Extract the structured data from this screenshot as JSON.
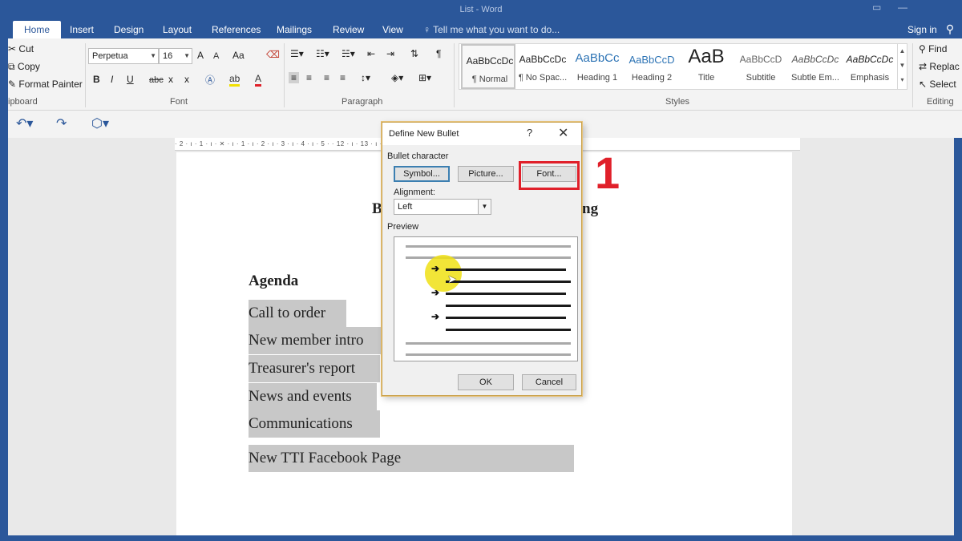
{
  "window": {
    "title": "List - Word"
  },
  "tabs": [
    "Home",
    "Insert",
    "Design",
    "Layout",
    "References",
    "Mailings",
    "Review",
    "View"
  ],
  "tell_me": "Tell me what you want to do...",
  "sign_in": "Sign in",
  "ribbon": {
    "clipboard": {
      "cut": "Cut",
      "copy": "Copy",
      "format_painter": "Format Painter",
      "label": "ipboard"
    },
    "font": {
      "name": "Perpetua",
      "size": "16",
      "label": "Font",
      "grow": "A",
      "shrink": "A",
      "case": "Aa",
      "bold": "B",
      "italic": "I",
      "underline": "U",
      "strike": "abc",
      "sub": "x",
      "sup": "x"
    },
    "paragraph": {
      "label": "Paragraph"
    },
    "styles": {
      "label": "Styles",
      "items": [
        {
          "preview": "AaBbCcDc",
          "name": "¶ Normal"
        },
        {
          "preview": "AaBbCcDc",
          "name": "¶ No Spac..."
        },
        {
          "preview": "AaBbCc",
          "name": "Heading 1"
        },
        {
          "preview": "AaBbCcD",
          "name": "Heading 2"
        },
        {
          "preview": "AaB",
          "name": "Title"
        },
        {
          "preview": "AaBbCcD",
          "name": "Subtitle"
        },
        {
          "preview": "AaBbCcDc",
          "name": "Subtle Em..."
        },
        {
          "preview": "AaBbCcDc",
          "name": "Emphasis"
        }
      ]
    },
    "editing": {
      "find": "Find",
      "replace": "Replac",
      "select": "Select",
      "label": "Editing"
    }
  },
  "ruler_text": "· 2 · ı · 1 · ı · ✕ · ı · 1 · ı · 2 · ı · 3 · ı · 4 · ı · 5 ·                                                 · 12 · ı · 13 · ı · 14 · ı · 15 · ı · 16 · △ · 17 · ı · 18 · ı · 19",
  "document": {
    "heading_left": "B",
    "heading_right": "ng",
    "agenda": "Agenda",
    "lines": [
      "Call to order",
      "New member intro",
      "Treasurer's report",
      "News and events",
      "Communications",
      "New TTI Facebook Page"
    ]
  },
  "dialog": {
    "title": "Define New Bullet",
    "help": "?",
    "close": "✕",
    "bullet_character": "Bullet character",
    "symbol_btn": "Symbol...",
    "picture_btn": "Picture...",
    "font_btn": "Font...",
    "alignment_label": "Alignment:",
    "alignment_value": "Left",
    "preview_label": "Preview",
    "ok": "OK",
    "cancel": "Cancel"
  },
  "annotation": {
    "step": "1",
    "color": "#e0202a"
  },
  "colors": {
    "accent": "#2b579a"
  }
}
